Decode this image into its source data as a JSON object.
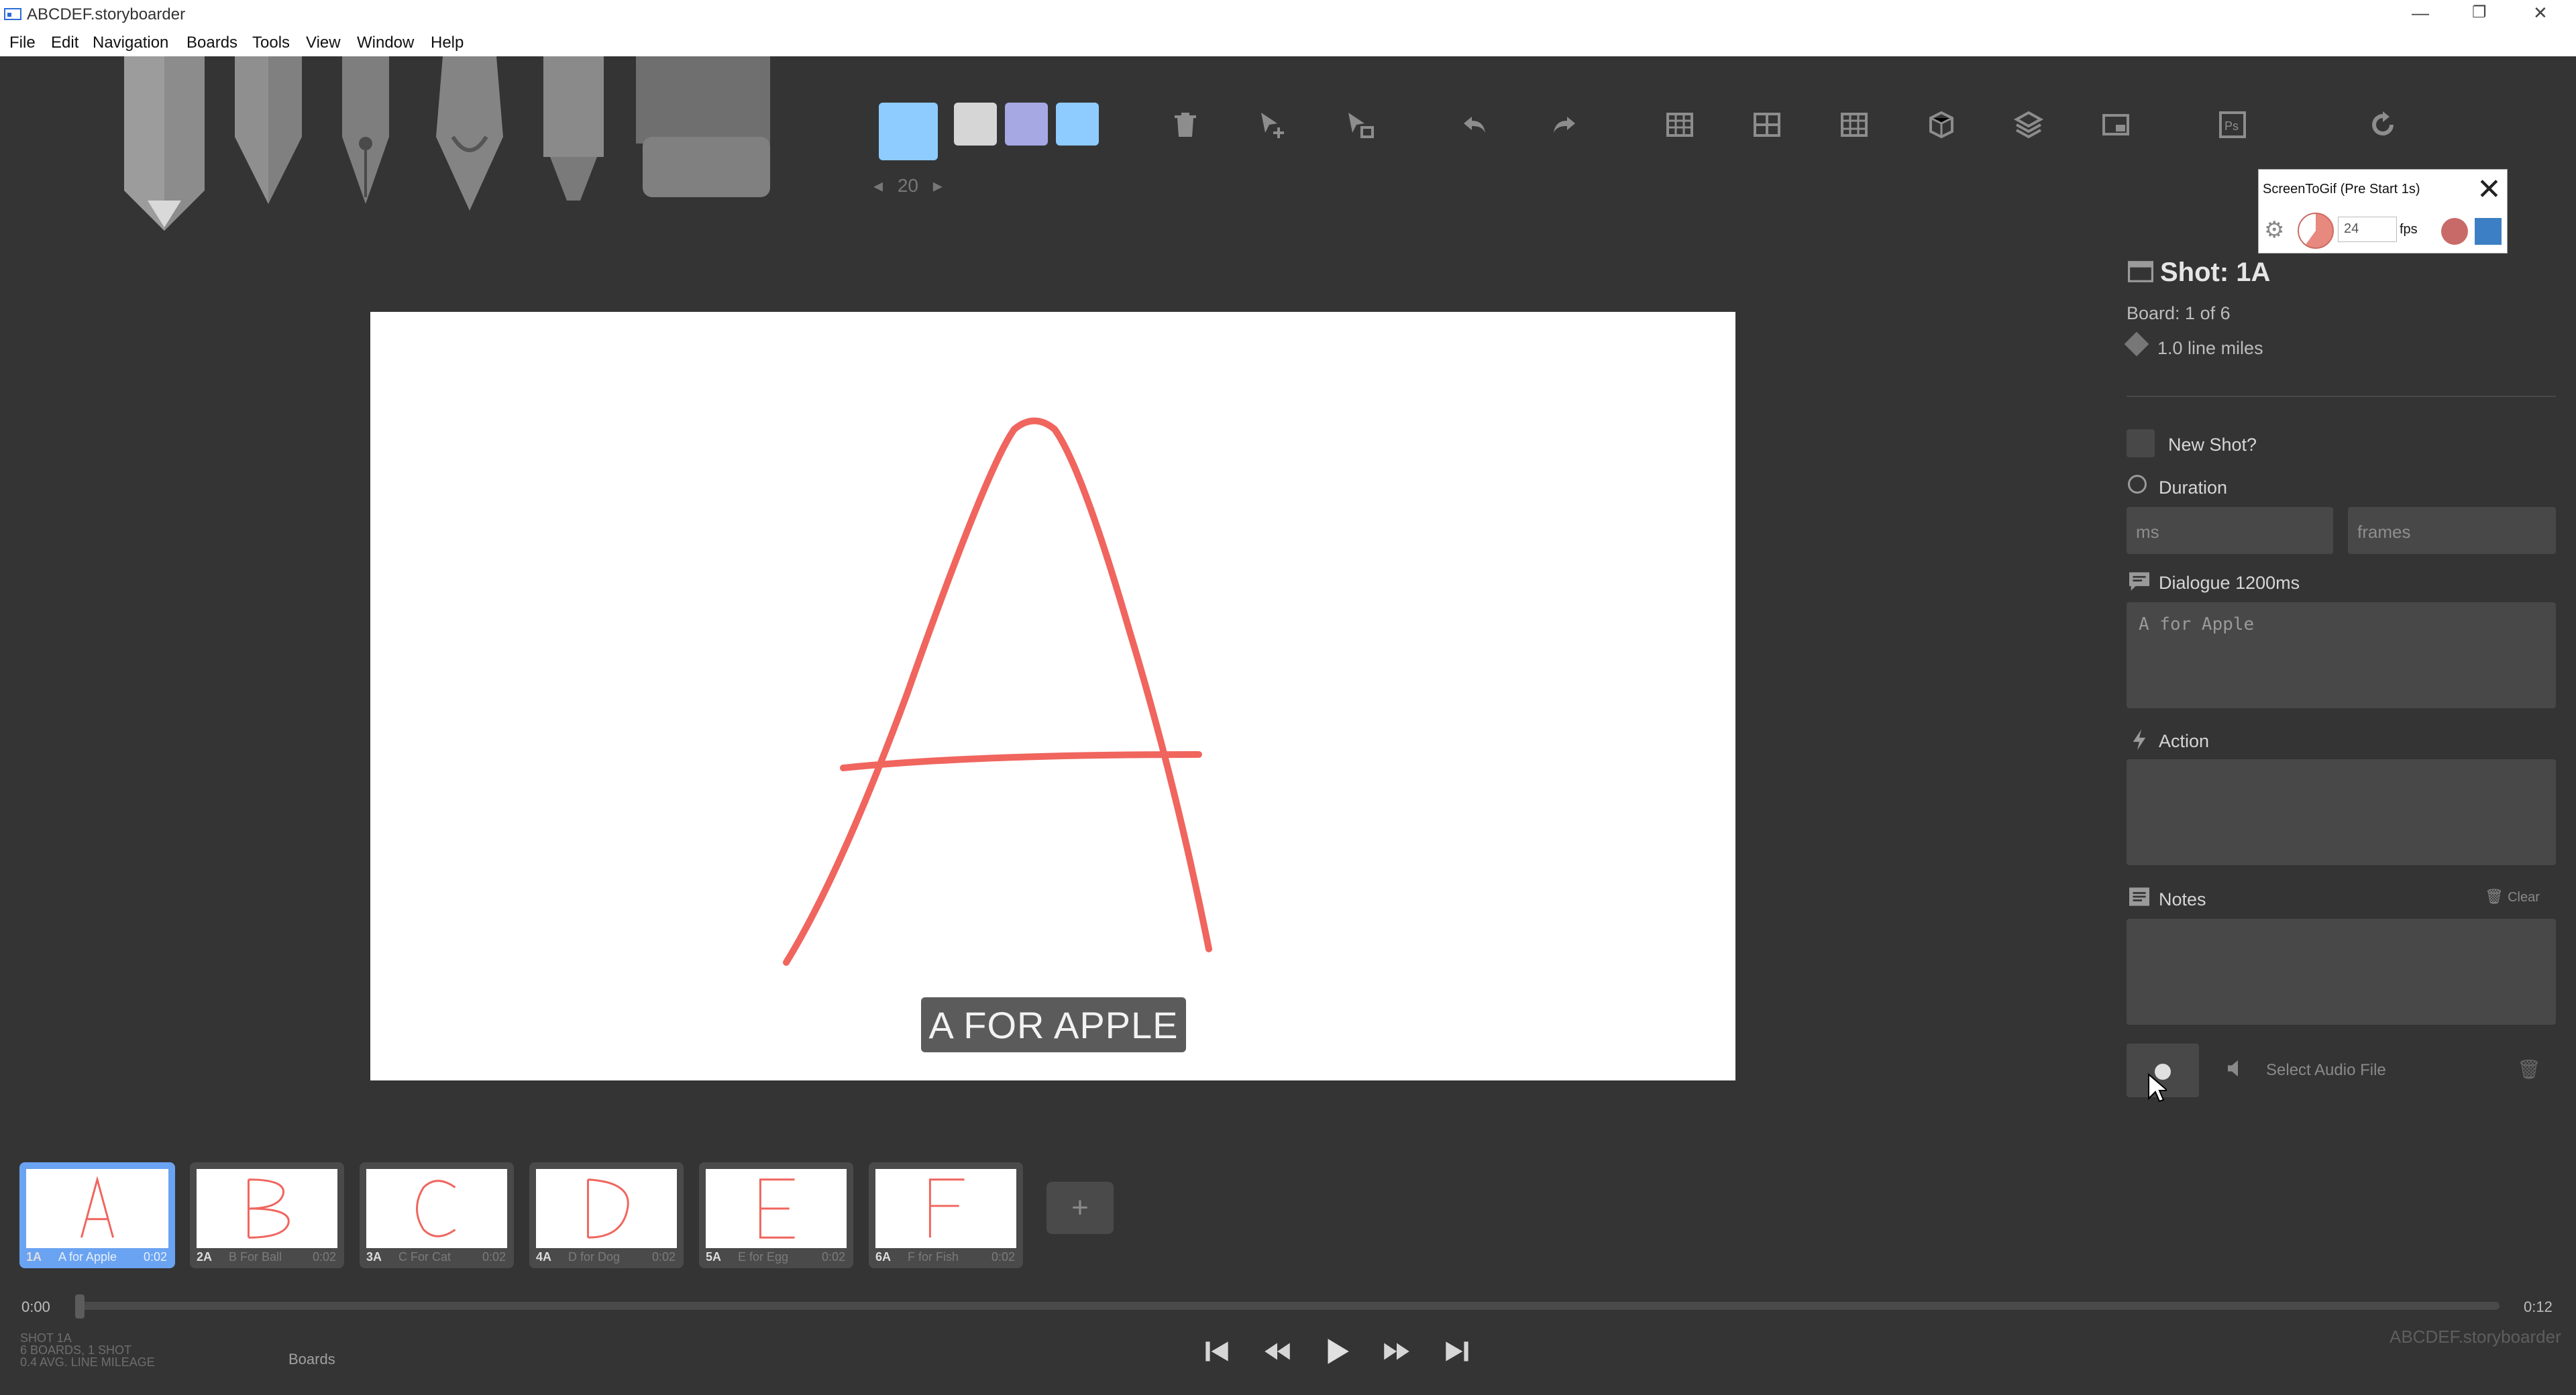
{
  "window": {
    "title": "ABCDEF.storyboarder"
  },
  "menu": [
    "File",
    "Edit",
    "Navigation",
    "Boards",
    "Tools",
    "View",
    "Window",
    "Help"
  ],
  "toolbar": {
    "brush_size": "20",
    "colors": [
      "#8ecbff",
      "#d6d6d6",
      "#a6a8e4",
      "#8ecbff"
    ]
  },
  "canvas": {
    "caption": "A FOR APPLE",
    "stroke_color": "#f0655e"
  },
  "screentogif": {
    "title": "ScreenToGif (Pre Start 1s)",
    "fps_value": "24",
    "fps_label": "fps"
  },
  "panel": {
    "shot_title": "Shot: 1A",
    "board_info": "Board: 1 of 6",
    "line_miles": "1.0 line miles",
    "new_shot_label": "New Shot?",
    "duration_label": "Duration",
    "ms_placeholder": "ms",
    "frames_placeholder": "frames",
    "dialogue_label": "Dialogue 1200ms",
    "dialogue_value": "A for Apple",
    "action_label": "Action",
    "notes_label": "Notes",
    "clear_label": "Clear",
    "audio_label": "Select Audio File"
  },
  "boards": [
    {
      "num": "1A",
      "caption": "A for Apple",
      "dur": "0:02",
      "letter": "A",
      "active": true
    },
    {
      "num": "2A",
      "caption": "B For Ball",
      "dur": "0:02",
      "letter": "B",
      "active": false
    },
    {
      "num": "3A",
      "caption": "C For Cat",
      "dur": "0:02",
      "letter": "C",
      "active": false
    },
    {
      "num": "4A",
      "caption": "D for Dog",
      "dur": "0:02",
      "letter": "D",
      "active": false
    },
    {
      "num": "5A",
      "caption": "E for Egg",
      "dur": "0:02",
      "letter": "E",
      "active": false
    },
    {
      "num": "6A",
      "caption": "F for Fish",
      "dur": "0:02",
      "letter": "F",
      "active": false
    }
  ],
  "timeline": {
    "start": "0:00",
    "end": "0:12"
  },
  "footer": {
    "stats": [
      "SHOT 1A",
      "6 BOARDS, 1 SHOT",
      "0.4 AVG. LINE MILEAGE"
    ],
    "boards_label": "Boards",
    "app_name": "ABCDEF.storyboarder"
  }
}
